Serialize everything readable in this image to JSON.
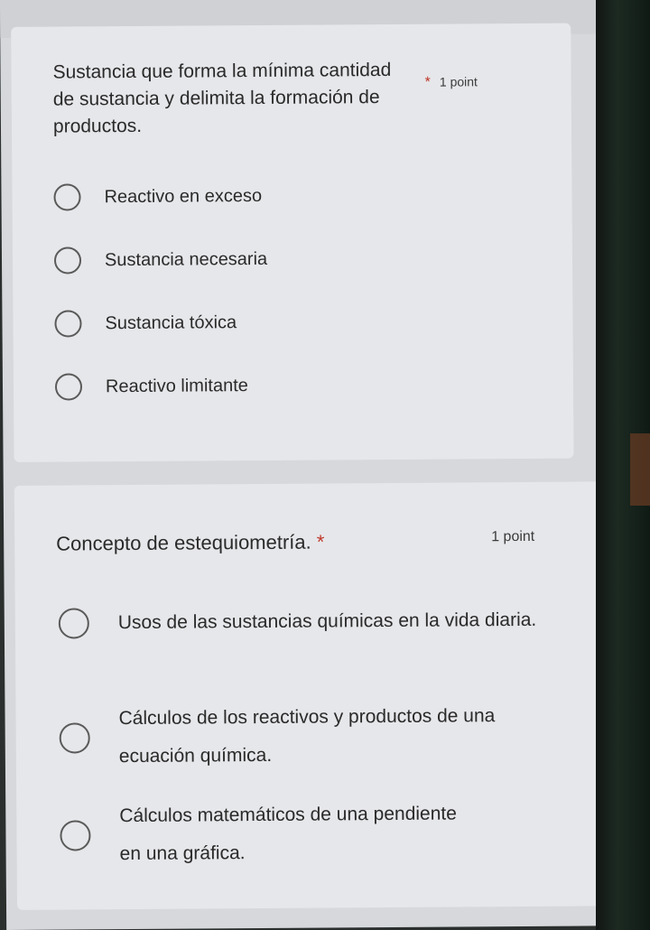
{
  "question_1": {
    "title": "Sustancia que forma la mínima cantidad de sustancia y delimita la formación de productos.",
    "required_star": "*",
    "points": "1 point",
    "options": [
      "Reactivo en exceso",
      "Sustancia necesaria",
      "Sustancia tóxica",
      "Reactivo limitante"
    ]
  },
  "question_2": {
    "title": "Concepto de estequiometría.",
    "required_star": "*",
    "points": "1 point",
    "options": [
      "Usos de las sustancias químicas en la vida diaria.",
      "Cálculos de los reactivos y productos de una ecuación química.",
      "Cálculos matemáticos de una pendiente en una gráfica."
    ]
  },
  "colors": {
    "background": "#d6d8dc",
    "card": "#e6e7ea",
    "required_star": "#c0392b",
    "radio_border": "#5a5a5a"
  }
}
